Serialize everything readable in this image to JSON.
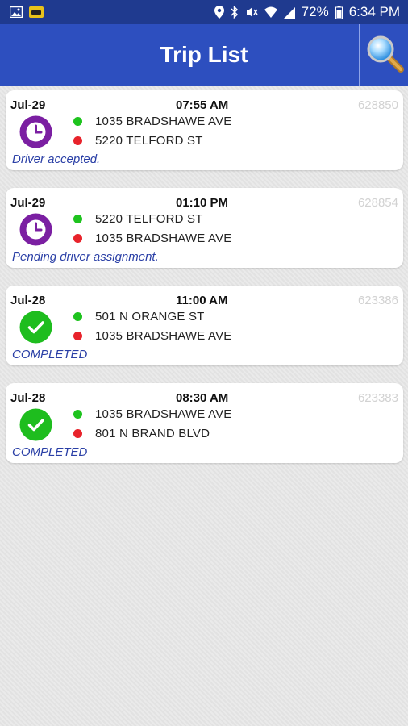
{
  "status_bar": {
    "battery_pct": "72%",
    "time": "6:34 PM",
    "left_icons": [
      "image-icon",
      "taxi-app-icon"
    ],
    "right_icons": [
      "location-icon",
      "bluetooth-icon",
      "mute-icon",
      "wifi-icon",
      "signal-icon",
      "battery-icon"
    ]
  },
  "app_bar": {
    "title": "Trip List",
    "search_icon": "magnifier-icon",
    "color": "#2d4fbf"
  },
  "trips": [
    {
      "date": "Jul-29",
      "time": "07:55 AM",
      "id": "628850",
      "pickup": "1035 BRADSHAWE AVE",
      "dropoff": "5220 TELFORD ST",
      "status": "Driver accepted.",
      "status_icon": "clock-icon"
    },
    {
      "date": "Jul-29",
      "time": "01:10 PM",
      "id": "628854",
      "pickup": "5220 TELFORD ST",
      "dropoff": "1035 BRADSHAWE AVE",
      "status": "Pending driver assignment.",
      "status_icon": "clock-icon"
    },
    {
      "date": "Jul-28",
      "time": "11:00 AM",
      "id": "623386",
      "pickup": "501 N ORANGE ST",
      "dropoff": "1035 BRADSHAWE AVE",
      "status": "COMPLETED",
      "status_icon": "check-icon"
    },
    {
      "date": "Jul-28",
      "time": "08:30 AM",
      "id": "623383",
      "pickup": "1035 BRADSHAWE AVE",
      "dropoff": "801 N BRAND BLVD",
      "status": "COMPLETED",
      "status_icon": "check-icon"
    }
  ],
  "colors": {
    "pending_icon": "#7b1fa2",
    "completed_icon": "#1ebd1e",
    "pickup_dot": "#1ec31e",
    "dropoff_dot": "#e8232b",
    "status_text": "#2a3fa6"
  }
}
